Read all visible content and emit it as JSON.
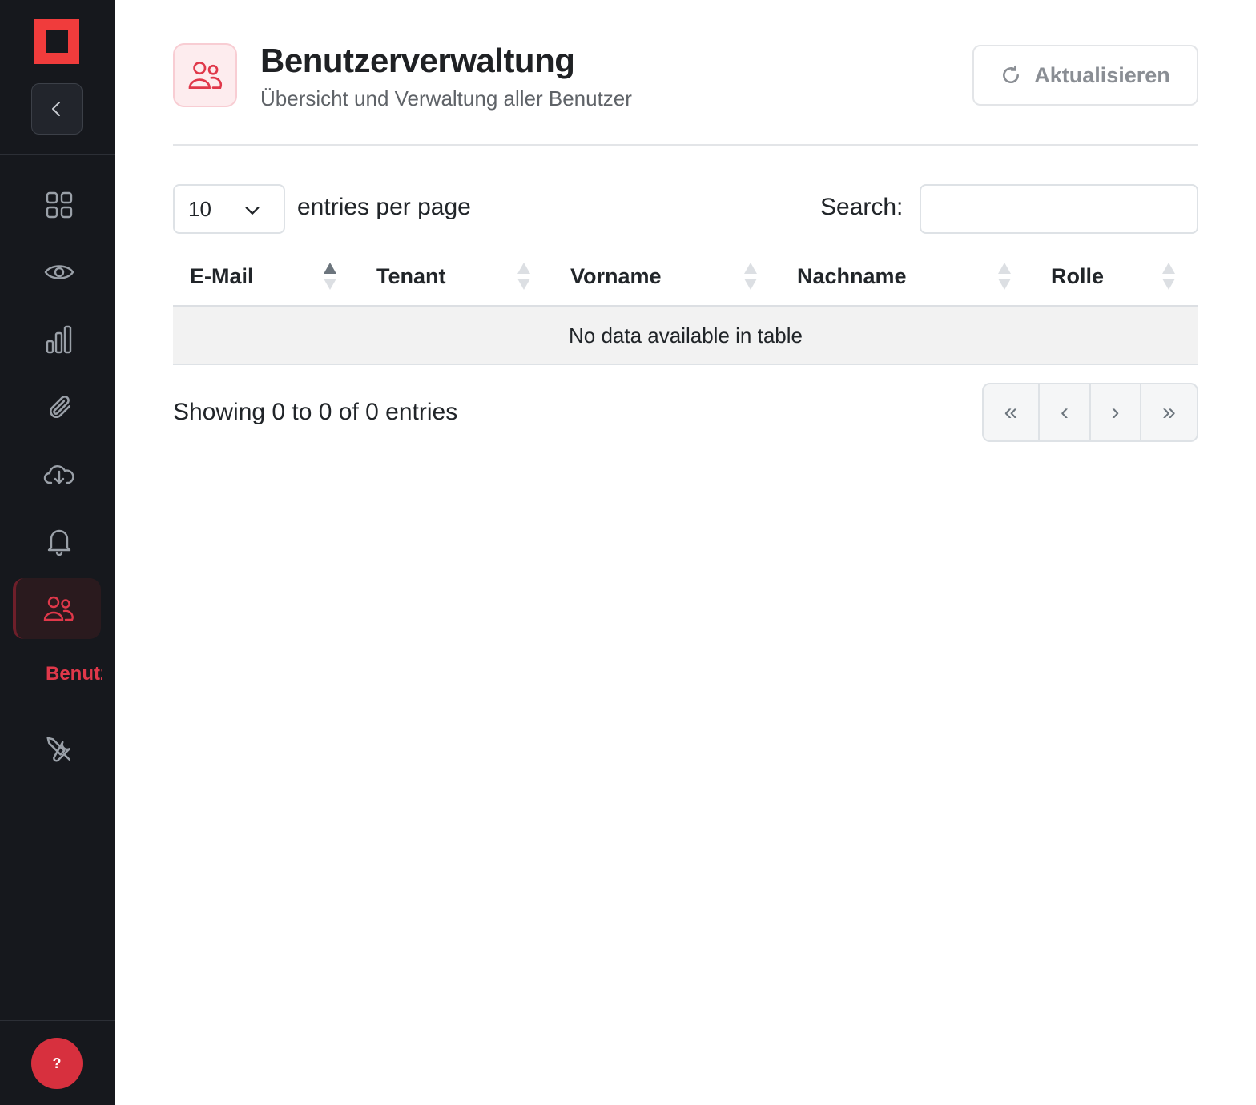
{
  "sidebar": {
    "active_label": "Benutzer",
    "help_label": "?",
    "items": [
      {
        "icon": "dashboard-grid-icon"
      },
      {
        "icon": "eye-icon"
      },
      {
        "icon": "bar-chart-icon"
      },
      {
        "icon": "paperclip-icon"
      },
      {
        "icon": "cloud-download-icon"
      },
      {
        "icon": "bell-icon"
      },
      {
        "icon": "users-icon"
      },
      {
        "icon": "tools-icon"
      }
    ]
  },
  "header": {
    "title": "Benutzerverwaltung",
    "subtitle": "Übersicht und Verwaltung aller Benutzer",
    "refresh_label": "Aktualisieren"
  },
  "controls": {
    "page_length": "10",
    "page_length_label": "entries per page",
    "search_label": "Search:",
    "search_value": ""
  },
  "table": {
    "columns": [
      "E-Mail",
      "Tenant",
      "Vorname",
      "Nachname",
      "Rolle"
    ],
    "empty_message": "No data available in table",
    "sorted_column": "E-Mail"
  },
  "footer": {
    "info": "Showing 0 to 0 of 0 entries",
    "pager": {
      "first": "«",
      "prev": "‹",
      "next": "›",
      "last": "»"
    }
  },
  "colors": {
    "sidebar_bg": "#16181d",
    "accent": "#e0384a",
    "logo": "#f03c3c"
  }
}
